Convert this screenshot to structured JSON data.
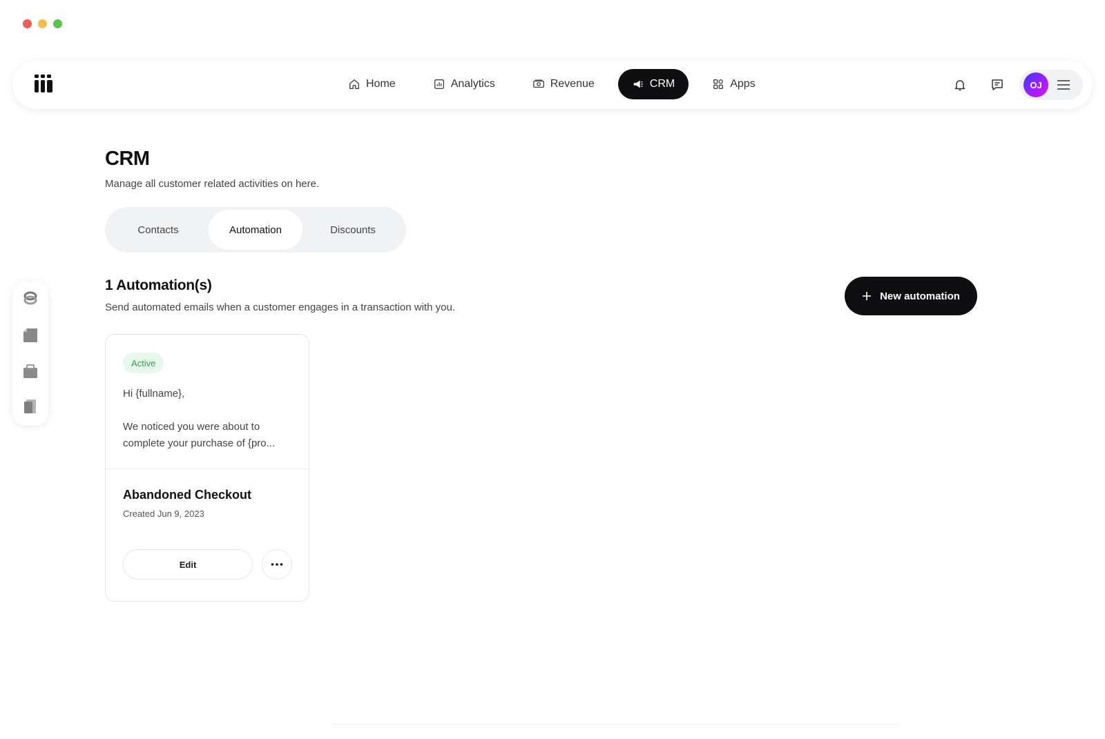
{
  "window": {
    "controls": [
      {
        "name": "close",
        "color": "#ed5e55"
      },
      {
        "name": "minimize",
        "color": "#f5bd4f"
      },
      {
        "name": "maximize",
        "color": "#5bc24d"
      }
    ]
  },
  "topbar": {
    "nav": [
      {
        "label": "Home",
        "icon": "home-icon",
        "active": false
      },
      {
        "label": "Analytics",
        "icon": "analytics-icon",
        "active": false
      },
      {
        "label": "Revenue",
        "icon": "revenue-icon",
        "active": false
      },
      {
        "label": "CRM",
        "icon": "megaphone-icon",
        "active": true
      },
      {
        "label": "Apps",
        "icon": "apps-icon",
        "active": false
      }
    ],
    "user": {
      "initials": "OJ"
    }
  },
  "sidebar": {
    "icons": [
      "link-icon",
      "invoice-icon",
      "store-icon",
      "media-icon"
    ]
  },
  "page": {
    "title": "CRM",
    "subtitle": "Manage all customer related activities on here.",
    "tabs": [
      {
        "label": "Contacts",
        "active": false
      },
      {
        "label": "Automation",
        "active": true
      },
      {
        "label": "Discounts",
        "active": false
      }
    ]
  },
  "automation": {
    "heading": "1 Automation(s)",
    "description": "Send automated emails when a customer engages in a transaction with you.",
    "new_button": "New automation",
    "cards": [
      {
        "status": "Active",
        "status_color": "#3c9c58",
        "preview_line1": "Hi {fullname},",
        "preview_line2": "We noticed you were about to complete your purchase of {pro...",
        "title": "Abandoned Checkout",
        "created": "Created Jun 9, 2023",
        "edit_label": "Edit"
      }
    ]
  },
  "colors": {
    "accent": "#0f0f12",
    "badge_bg": "#e7f8ec",
    "tab_bg": "#f1f2f4"
  }
}
